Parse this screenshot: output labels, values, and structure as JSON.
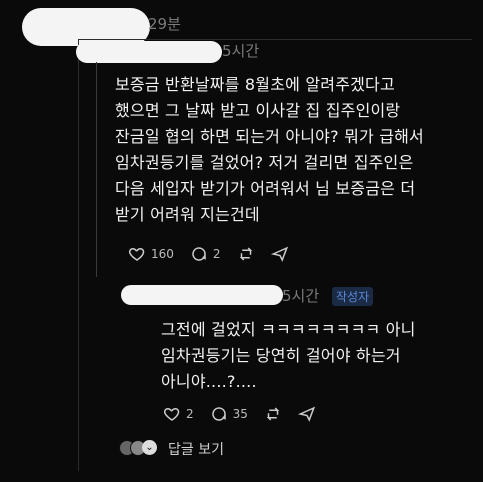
{
  "header": {
    "time": "29분"
  },
  "comment": {
    "time": "5시간",
    "text": "보증금 반환날짜를 8월초에 알려주겠다고\n했으면 그 날짜 받고 이사갈 집 집주인이랑\n잔금일 협의 하면 되는거 아니야? 뭐가 급해서\n임차권등기를 걸었어? 저거 걸리면 집주인은\n다음 세입자 받기가 어려워서 님 보증금은 더\n받기 어려워 지는건데",
    "likes": "160",
    "comments": "2"
  },
  "reply": {
    "time": "5시간",
    "badge": "작성자",
    "text": "그전에 걸었지 ㅋㅋㅋㅋㅋㅋㅋㅋ 아니\n임차권등기는 당연히 걸어야 하는거\n아니야....?....",
    "likes": "2",
    "comments": "35"
  },
  "footer": {
    "view_replies": "답글 보기"
  }
}
